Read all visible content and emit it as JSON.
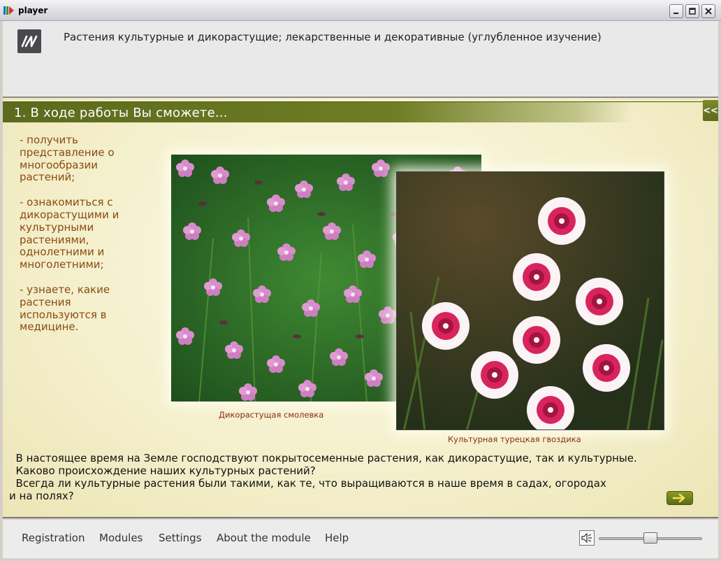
{
  "window": {
    "title": "player"
  },
  "header": {
    "logo_text": "И",
    "heading": "Растения культурные и дикорастущие; лекарственные и декоративные (углубленное изучение)"
  },
  "section": {
    "title": "1. В ходе работы Вы сможете...",
    "collapse_label": "<<"
  },
  "bullets": [
    [
      "- получить",
      "представление о",
      "многообразии",
      "растений;"
    ],
    [
      "- ознакомиться с",
      "дикорастущими и",
      "культурными",
      "растениями,",
      "однолетними и",
      "многолетними;"
    ],
    [
      "- узнаете, какие",
      "растения",
      "используются в",
      "медицине."
    ]
  ],
  "images": [
    {
      "caption": "Дикорастущая смолевка"
    },
    {
      "caption": "Культурная турецкая гвоздика"
    }
  ],
  "paragraph": {
    "lines": [
      "  В настоящее время на Земле господствуют покрытосеменные растения, как дикорастущие, так и культурные.",
      "  Каково происхождение наших культурных растений?",
      "  Всегда ли культурные растения были такими, как те, что выращиваются в наше время в садах, огородах",
      "и на полях?"
    ]
  },
  "footer": {
    "menu": [
      "Registration",
      "Modules",
      "Settings",
      "About the module",
      "Help"
    ],
    "volume": 0.5
  },
  "colors": {
    "accent": "#6f7d24",
    "bullet_text": "#8a4b10",
    "caption_text": "#8a2e10"
  }
}
